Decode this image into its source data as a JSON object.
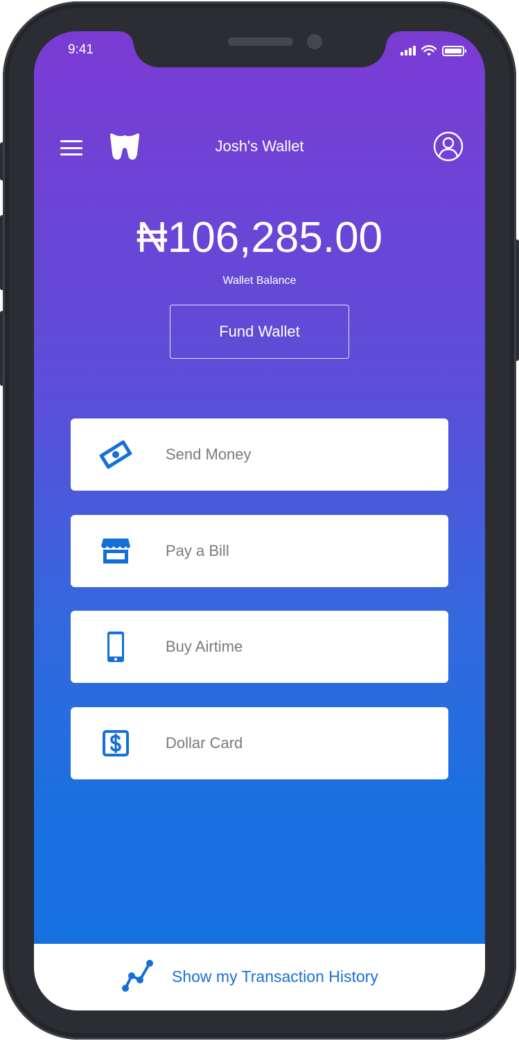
{
  "status_bar": {
    "time": "9:41"
  },
  "header": {
    "title": "Josh's Wallet"
  },
  "balance": {
    "amount": "₦106,285.00",
    "label": "Wallet Balance"
  },
  "fund_button": {
    "label": "Fund Wallet"
  },
  "actions": [
    {
      "label": "Send Money",
      "icon": "money-icon"
    },
    {
      "label": "Pay a Bill",
      "icon": "store-icon"
    },
    {
      "label": "Buy Airtime",
      "icon": "phone-icon"
    },
    {
      "label": "Dollar Card",
      "icon": "dollar-card-icon"
    }
  ],
  "footer": {
    "label": "Show my Transaction History",
    "icon": "trend-line-icon"
  },
  "colors": {
    "gradient_top": "#7b3bd3",
    "gradient_bottom": "#1570e0",
    "icon_blue": "#1470d6",
    "link_blue": "#1a6fd6",
    "card_text": "#7a7a7a"
  }
}
